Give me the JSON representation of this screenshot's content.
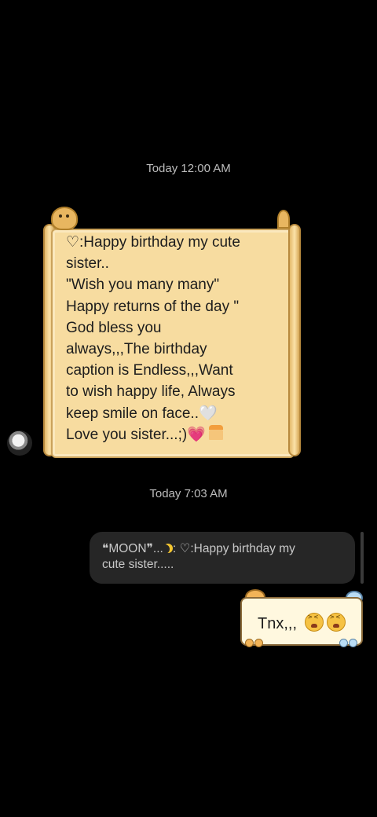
{
  "chat": {
    "timestamp_1": "Today 12:00 AM",
    "timestamp_2": "Today 7:03 AM",
    "incoming": {
      "lines": [
        "♡:Happy birthday my cute",
        "sister..",
        "\"Wish you many many\"",
        "Happy returns of the day \"",
        "God bless you",
        "always,,,The birthday",
        "caption is Endless,,,Want",
        "to wish happy life, Always",
        "keep smile on face..🤍",
        "Love you sister...;)💗"
      ],
      "sender_avatar_icon": "avatar-icon",
      "bubble_style": "scroll-sticker",
      "paper_color": "#f7dca0"
    },
    "reply_quote": {
      "line_1_prefix": "❝MOON❞...",
      "line_1_suffix": ": ♡:Happy birthday my",
      "line_2": "cute sister....."
    },
    "outgoing": {
      "text": "Tnx,,,",
      "emoji_icons": [
        "tired-face-icon",
        "tired-face-icon"
      ],
      "bubble_style": "note-sticker"
    }
  },
  "colors": {
    "background": "#000000",
    "timestamp": "#bdbdbd",
    "quote_bubble": "#262626",
    "note_bubble": "#fff8df"
  }
}
